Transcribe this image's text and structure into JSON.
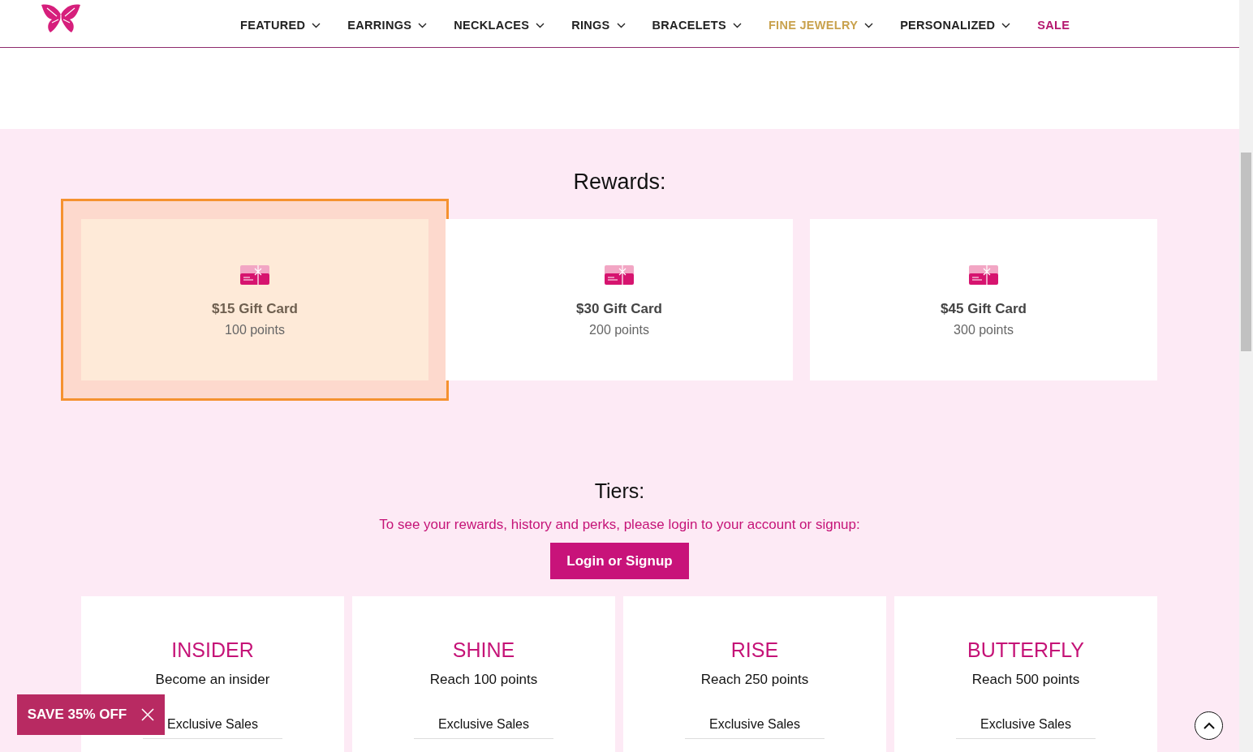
{
  "nav": {
    "items": [
      {
        "label": "FEATURED",
        "kind": "normal",
        "dropdown": true
      },
      {
        "label": "EARRINGS",
        "kind": "normal",
        "dropdown": true
      },
      {
        "label": "NECKLACES",
        "kind": "normal",
        "dropdown": true
      },
      {
        "label": "RINGS",
        "kind": "normal",
        "dropdown": true
      },
      {
        "label": "BRACELETS",
        "kind": "normal",
        "dropdown": true
      },
      {
        "label": "FINE JEWELRY",
        "kind": "gold",
        "dropdown": true
      },
      {
        "label": "PERSONALIZED",
        "kind": "normal",
        "dropdown": true
      },
      {
        "label": "SALE",
        "kind": "sale",
        "dropdown": false
      }
    ]
  },
  "rewards": {
    "title": "Rewards:",
    "items": [
      {
        "name": "$15 Gift Card",
        "points": "100 points",
        "highlighted": true
      },
      {
        "name": "$30 Gift Card",
        "points": "200 points",
        "highlighted": false
      },
      {
        "name": "$45 Gift Card",
        "points": "300 points",
        "highlighted": false
      }
    ]
  },
  "tiers": {
    "title": "Tiers:",
    "message": "To see your rewards, history and perks, please login to your account or signup:",
    "button": "Login or Signup",
    "items": [
      {
        "name": "INSIDER",
        "requirement": "Become an insider",
        "perk": "Exclusive Sales"
      },
      {
        "name": "SHINE",
        "requirement": "Reach 100 points",
        "perk": "Exclusive Sales"
      },
      {
        "name": "RISE",
        "requirement": "Reach 250 points",
        "perk": "Exclusive Sales"
      },
      {
        "name": "BUTTERFLY",
        "requirement": "Reach 500 points",
        "perk": "Exclusive Sales"
      }
    ]
  },
  "promo": {
    "label": "SAVE 35% OFF"
  }
}
